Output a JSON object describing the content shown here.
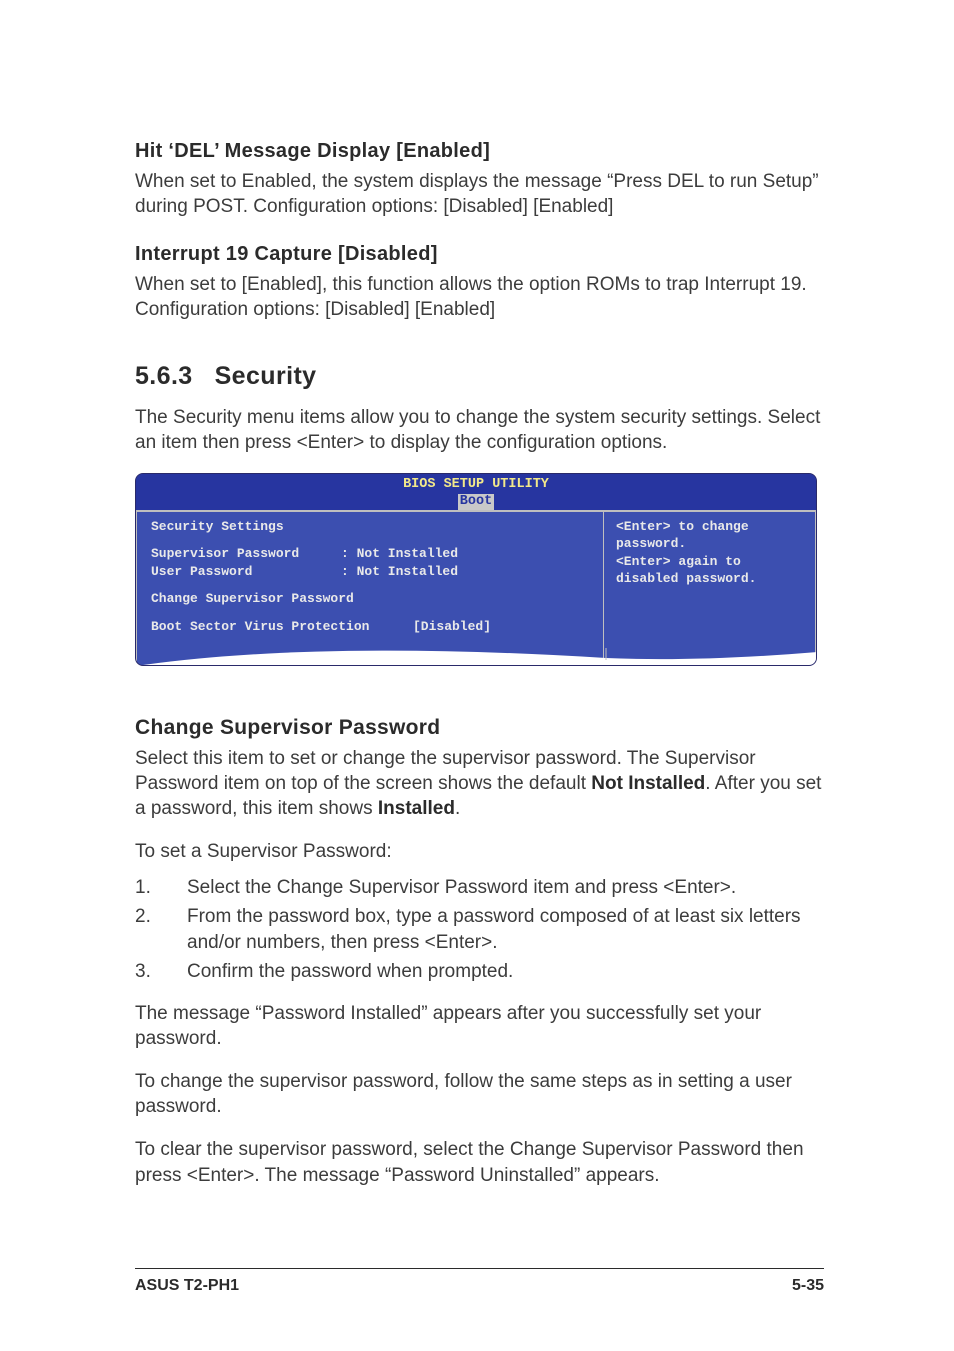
{
  "h1_del": "Hit ‘DEL’ Message Display [Enabled]",
  "p_del": "When set to Enabled, the system displays the message “Press DEL to run Setup” during POST. Configuration options: [Disabled] [Enabled]",
  "h1_int": "Interrupt 19 Capture [Disabled]",
  "p_int": "When set to [Enabled], this function allows the option ROMs to trap Interrupt 19. Configuration options: [Disabled] [Enabled]",
  "sec_num": "5.6.3",
  "sec_title": "Security",
  "sec_intro": "The Security menu items allow you to change the system security settings. Select an item then press <Enter> to display the configuration options.",
  "bios": {
    "title": "BIOS SETUP UTILITY",
    "tab": "Boot",
    "left_heading": "Security Settings",
    "row1_label": "Supervisor Password",
    "row1_value": ": Not Installed",
    "row2_label": "User Password",
    "row2_value": ": Not Installed",
    "row3": "Change Supervisor Password",
    "row4_label": "Boot Sector Virus Protection",
    "row4_value": "[Disabled]",
    "help": "<Enter> to change\npassword.\n<Enter> again to\ndisabled password."
  },
  "h_csp": "Change Supervisor Password",
  "csp_p1a": "Select this item to set or change the supervisor password. The Supervisor Password item on top of the screen shows the default ",
  "csp_p1b": "Not Installed",
  "csp_p1c": ". After you set a password, this item shows ",
  "csp_p1d": "Installed",
  "csp_p1e": ".",
  "csp_p2": "To set a Supervisor Password:",
  "steps": {
    "s1": "Select the Change Supervisor Password item and press <Enter>.",
    "s2": "From the password box, type a password composed of at least six letters and/or numbers, then press <Enter>.",
    "s3": "Confirm the password when prompted."
  },
  "csp_p3": "The message “Password Installed” appears after you successfully set your password.",
  "csp_p4": "To change the supervisor password, follow the same steps as in setting a user password.",
  "csp_p5": "To clear the supervisor password, select the Change Supervisor Password then press <Enter>. The message “Password Uninstalled” appears.",
  "footer_left": "ASUS T2-PH1",
  "footer_right": "5-35"
}
